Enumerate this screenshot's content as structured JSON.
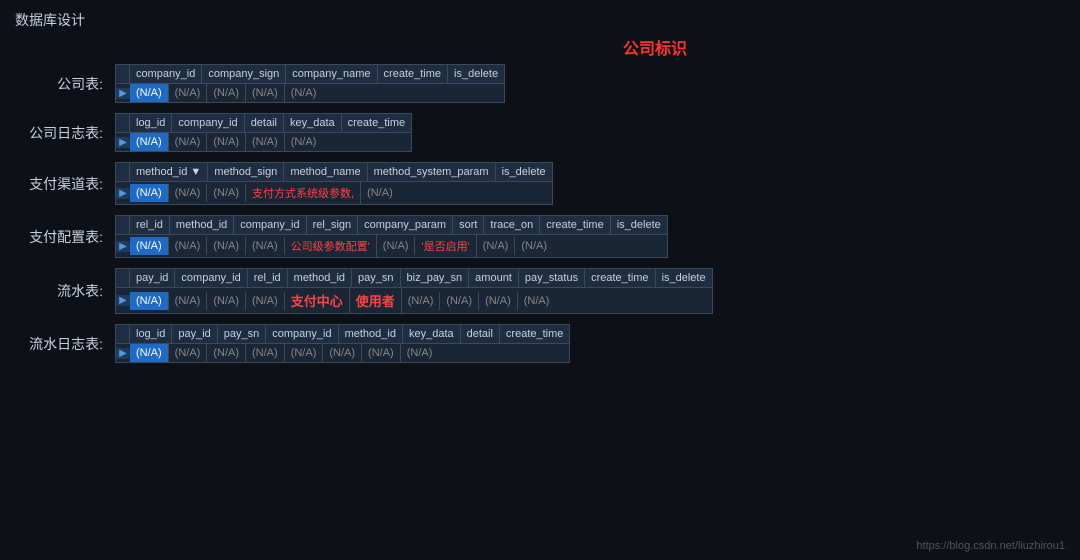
{
  "page": {
    "title": "数据库设计",
    "company_label": "公司标识",
    "footer_url": "https://blog.csdn.net/liuzhirou1"
  },
  "tables": [
    {
      "label": "公司表:",
      "columns": [
        "company_id",
        "company_sign",
        "company_name",
        "create_time",
        "is_delete"
      ],
      "row": [
        "(N/A)",
        "(N/A)",
        "(N/A)",
        "(N/A)",
        "(N/A)"
      ],
      "highlighted_col": 0,
      "special_cols": []
    },
    {
      "label": "公司日志表:",
      "columns": [
        "log_id",
        "company_id",
        "detail",
        "key_data",
        "create_time"
      ],
      "row": [
        "(N/A)",
        "(N/A)",
        "(N/A)",
        "(N/A)",
        "(N/A)"
      ],
      "highlighted_col": 0,
      "special_cols": []
    },
    {
      "label": "支付渠道表:",
      "columns": [
        "method_id ▼",
        "method_sign",
        "method_name",
        "method_system_param",
        "is_delete"
      ],
      "row": [
        "(N/A)",
        "(N/A)",
        "(N/A)",
        "支付方式系统级参数,",
        "(N/A)"
      ],
      "highlighted_col": 0,
      "special_cols": [
        3
      ]
    },
    {
      "label": "支付配置表:",
      "columns": [
        "rel_id",
        "method_id",
        "company_id",
        "rel_sign",
        "company_param",
        "sort",
        "trace_on",
        "create_time",
        "is_delete"
      ],
      "row": [
        "(N/A)",
        "(N/A)",
        "(N/A)",
        "(N/A)",
        "公司级参数配置'",
        "(N/A)",
        "'是否启用'",
        "(N/A)",
        "(N/A)"
      ],
      "highlighted_col": 0,
      "special_cols": [
        4,
        6
      ]
    },
    {
      "label": "流水表:",
      "columns": [
        "pay_id",
        "company_id",
        "rel_id",
        "method_id",
        "pay_sn",
        "biz_pay_sn",
        "amount",
        "pay_status",
        "create_time",
        "is_delete"
      ],
      "row": [
        "(N/A)",
        "(N/A)",
        "(N/A)",
        "(N/A)",
        "支付中心",
        "使用者",
        "(N/A)",
        "(N/A)",
        "(N/A)",
        "(N/A)"
      ],
      "highlighted_col": 0,
      "special_center": [
        4,
        5
      ]
    },
    {
      "label": "流水日志表:",
      "columns": [
        "log_id",
        "pay_id",
        "pay_sn",
        "company_id",
        "method_id",
        "key_data",
        "detail",
        "create_time"
      ],
      "row": [
        "(N/A)",
        "(N/A)",
        "(N/A)",
        "(N/A)",
        "(N/A)",
        "(N/A)",
        "(N/A)",
        "(N/A)"
      ],
      "highlighted_col": 0,
      "special_cols": []
    }
  ]
}
